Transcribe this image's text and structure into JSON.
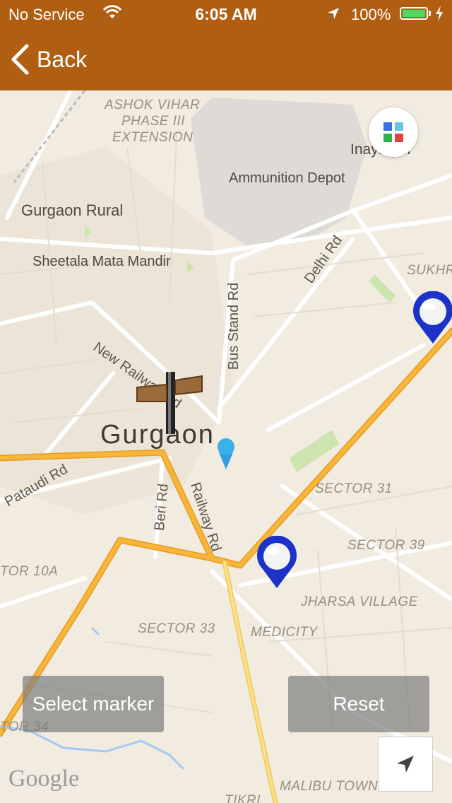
{
  "status_bar": {
    "carrier": "No Service",
    "time": "6:05 AM",
    "battery": "100%",
    "battery_level": 1.0
  },
  "nav": {
    "back_label": "Back"
  },
  "map": {
    "labels": {
      "ashok_vihar": "ASHOK VIHAR",
      "phase_iii": "PHASE III",
      "extension": "EXTENSION",
      "inayatpur": "Inayatpur",
      "ammunition": "Ammunition Depot",
      "gurgaon_rural": "Gurgaon Rural",
      "sheetala": "Sheetala Mata Mandir",
      "sukhr": "SUKHR",
      "bus_stand": "Bus Stand Rd",
      "delhi_rd": "Delhi Rd",
      "new_railway": "New Railway Rd",
      "gurgaon": "Gurgaon",
      "pataudi": "Pataudi Rd",
      "beri": "Beri Rd",
      "railway": "Railway Rd",
      "sector31": "SECTOR 31",
      "sector39": "SECTOR 39",
      "sector10a": "TOR 10A",
      "jharsa": "JHARSA VILLAGE",
      "medicity": "MEDICITY",
      "sector33": "SECTOR 33",
      "sector34": "TOR 34",
      "malibu": "MALIBU TOWN",
      "tikri": "TIKRI"
    },
    "google": "Google"
  },
  "buttons": {
    "select_marker": "Select marker",
    "reset": "Reset"
  },
  "colors": {
    "nav_bg": "#b05f12",
    "highway": "#f6a623",
    "marker_blue": "#1b33c9"
  }
}
